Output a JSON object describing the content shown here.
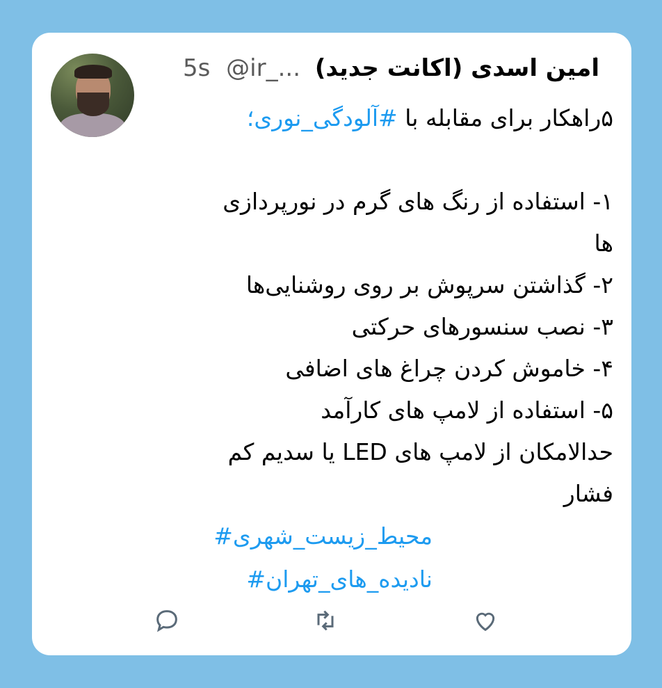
{
  "tweet": {
    "display_name": "امین اسدی (اکانت جدید)",
    "handle": "@ir_...",
    "time": "5s",
    "menu_icon": "more-vertical-icon",
    "lines": [
      {
        "text": "۵راهکار برای مقابله با "
      },
      {
        "text": ""
      },
      {
        "text": "۱- استفاده از رنگ های گرم در نورپردازی"
      },
      {
        "text": "ها"
      },
      {
        "text": "۲- گذاشتن سرپوش بر روی روشنایی‌ها"
      },
      {
        "text": "۳- نصب سنسورهای حرکتی"
      },
      {
        "text": "۴- خاموش کردن چراغ های اضافی"
      },
      {
        "text": "۵- استفاده از لامپ های کارآمد"
      },
      {
        "text": "حدالامکان از لامپ های LED یا سدیم کم"
      },
      {
        "text": "فشار"
      }
    ],
    "inline_hashtag": "#آلودگی_نوری؛",
    "hashtags": [
      "محیط_زیست_شهری#",
      "نادیده_های_تهران#"
    ]
  },
  "actions": {
    "reply_icon": "reply-icon",
    "retweet_icon": "retweet-icon",
    "like_icon": "heart-icon"
  },
  "colors": {
    "background": "#7fbfe6",
    "card": "#ffffff",
    "link": "#1d9bf0",
    "icon": "#5a6a78"
  }
}
